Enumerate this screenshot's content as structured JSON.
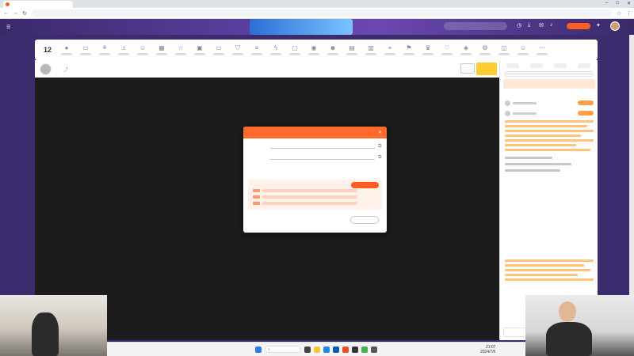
{
  "browser": {
    "tab_title": "",
    "url": ""
  },
  "site": {
    "logo": "",
    "nav": [
      "",
      "",
      "",
      ""
    ]
  },
  "toolbar": {
    "count": "12",
    "items": [
      "",
      "",
      "",
      "",
      "",
      "",
      "",
      "",
      "",
      "",
      "",
      "",
      "",
      "",
      "",
      "",
      "",
      "",
      "",
      "",
      "",
      "",
      "",
      "",
      "",
      ""
    ]
  },
  "streamer": {
    "name": "",
    "level": ""
  },
  "modal": {
    "title": "",
    "server_label": "",
    "server_value": "",
    "key_label": "",
    "key_value": "",
    "copy": "",
    "note": "",
    "box_title": "",
    "install": "",
    "obs_title": "",
    "obs_desc": "",
    "download": ""
  },
  "chat": {
    "tabs": [
      "",
      "",
      "",
      ""
    ]
  },
  "taskbar": {
    "search": "",
    "time": "21:07",
    "date": "2024/7/6"
  },
  "colors": {
    "accent": "#ff5d23",
    "header_purple": "#5b3fa0",
    "page_bg": "#3c2c6e"
  }
}
